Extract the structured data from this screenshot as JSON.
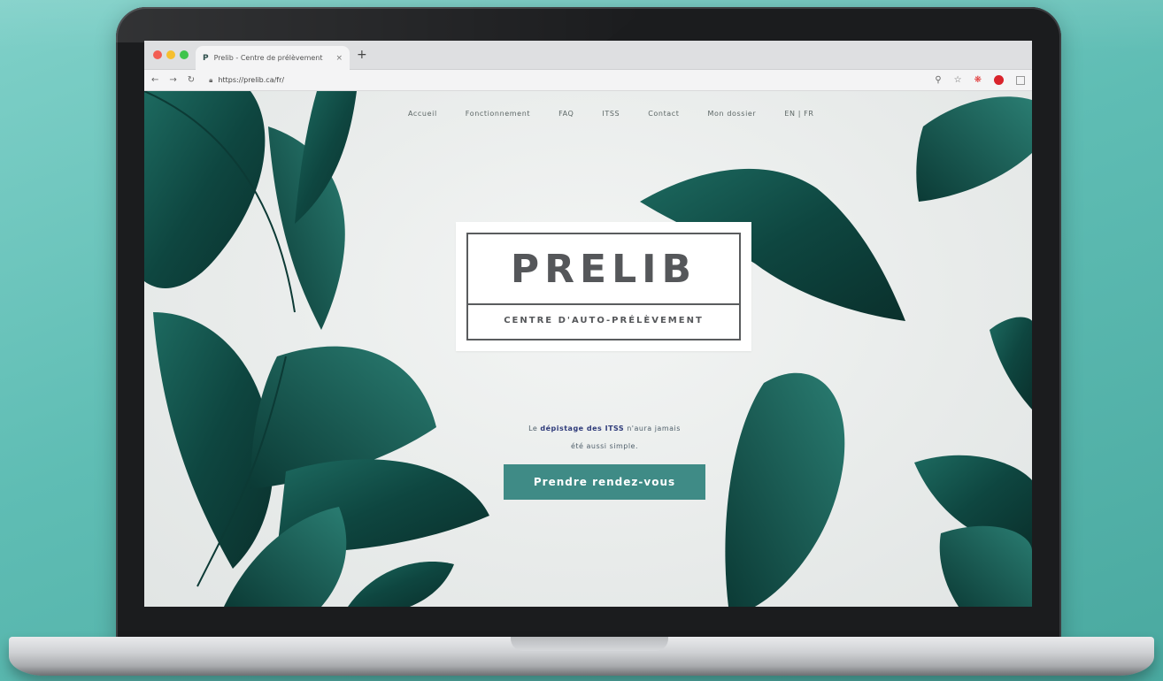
{
  "browser": {
    "tab": {
      "favicon": "P",
      "title": "Prelib - Centre de prélèvement",
      "close_glyph": "×"
    },
    "new_tab_glyph": "+",
    "nav": {
      "back": "←",
      "forward": "→",
      "reload": "↻"
    },
    "url": "https://prelib.ca/fr/",
    "toolbar_icons": [
      "zoom-icon",
      "star-icon",
      "extension-icon",
      "stop-icon",
      "menu-box-icon"
    ]
  },
  "site": {
    "nav": {
      "items": [
        "Accueil",
        "Fonctionnement",
        "FAQ",
        "ITSS",
        "Contact",
        "Mon dossier"
      ],
      "lang": "EN | FR"
    },
    "logo": {
      "title": "PRELIB",
      "subtitle": "CENTRE D'AUTO-PRÉLÈVEMENT"
    },
    "tagline": {
      "pre": "Le ",
      "bold": "dépistage des ITSS",
      "post": " n'aura jamais",
      "line2": "été aussi simple."
    },
    "cta_label": "Prendre rendez-vous"
  },
  "colors": {
    "background": "#5fbdb4",
    "leaf": "#0f4a44",
    "cta": "#3f8b86",
    "logo_text": "#55575a"
  }
}
